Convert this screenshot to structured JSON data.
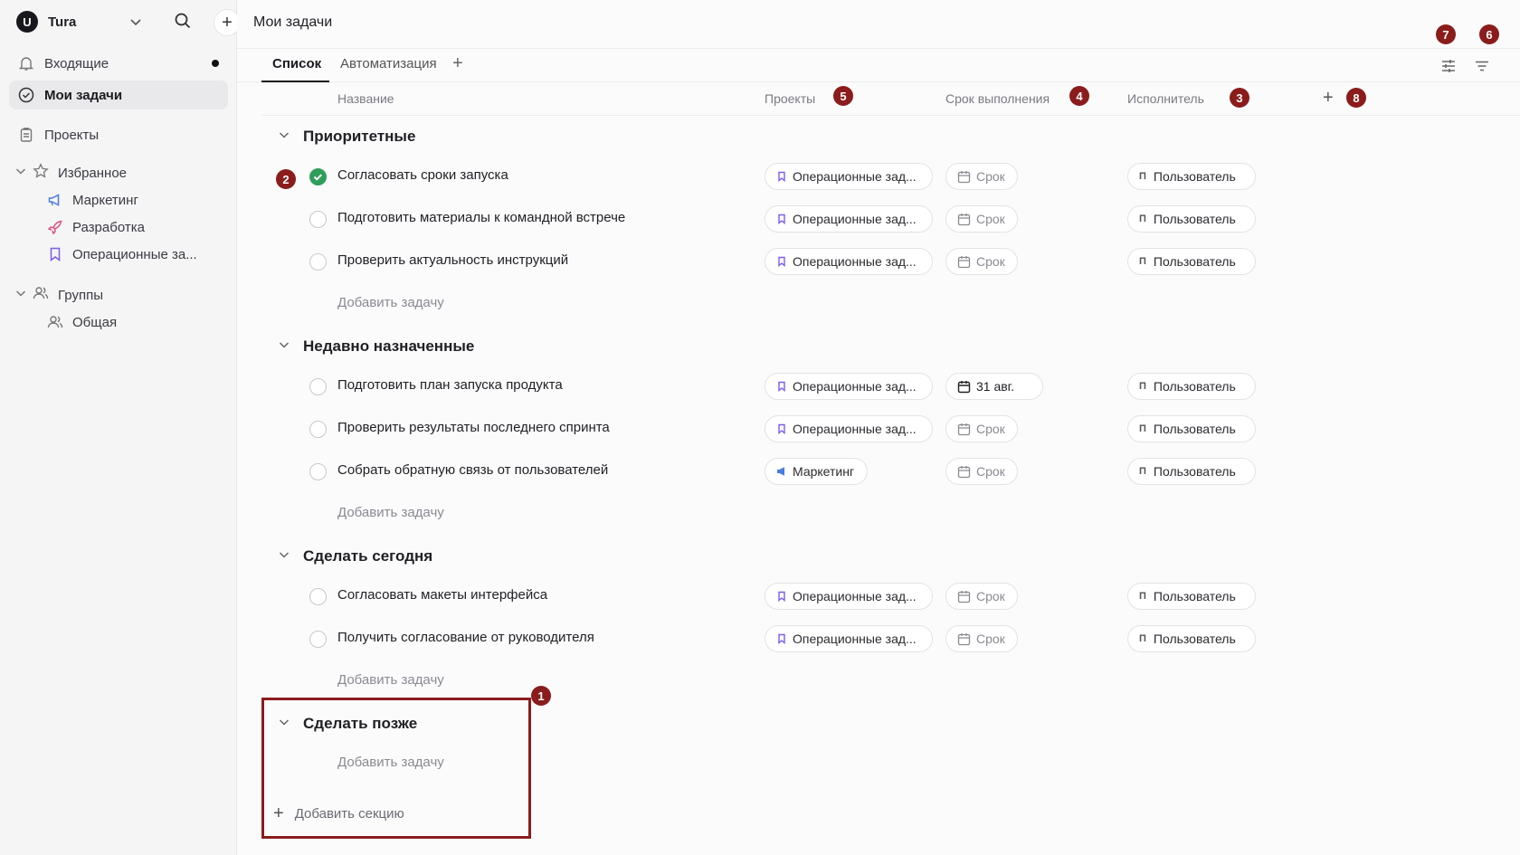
{
  "workspace": {
    "logo": "U",
    "name": "Tura"
  },
  "sidebar": {
    "inbox": "Входящие",
    "my_tasks": "Мои задачи",
    "projects": "Проекты",
    "favorites": {
      "label": "Избранное",
      "items": [
        "Маркетинг",
        "Разработка",
        "Операционные за..."
      ]
    },
    "groups": {
      "label": "Группы",
      "items": [
        "Общая"
      ]
    }
  },
  "header": {
    "title": "Мои задачи"
  },
  "tabs": {
    "list": "Список",
    "automation": "Автоматизация",
    "add": "+"
  },
  "columns": {
    "name": "Название",
    "projects": "Проекты",
    "due": "Срок выполнения",
    "assignee": "Исполнитель",
    "add": "+"
  },
  "sections": [
    {
      "title": "Приоритетные",
      "tasks": [
        {
          "title": "Согласовать сроки запуска",
          "done": true,
          "project": "Операционные зад...",
          "due": "Срок",
          "assignee": "Пользователь"
        },
        {
          "title": "Подготовить материалы к командной встрече",
          "done": false,
          "project": "Операционные зад...",
          "due": "Срок",
          "assignee": "Пользователь"
        },
        {
          "title": "Проверить актуальность инструкций",
          "done": false,
          "project": "Операционные зад...",
          "due": "Срок",
          "assignee": "Пользователь"
        }
      ],
      "add_task": "Добавить задачу"
    },
    {
      "title": "Недавно назначенные",
      "tasks": [
        {
          "title": "Подготовить план запуска продукта",
          "done": false,
          "project": "Операционные зад...",
          "due": "31 авг.",
          "assignee": "Пользователь"
        },
        {
          "title": "Проверить результаты последнего спринта",
          "done": false,
          "project": "Операционные зад...",
          "due": "Срок",
          "assignee": "Пользователь"
        },
        {
          "title": "Собрать обратную связь от пользователей",
          "done": false,
          "project": "Маркетинг",
          "due": "Срок",
          "assignee": "Пользователь"
        }
      ],
      "add_task": "Добавить задачу"
    },
    {
      "title": "Сделать сегодня",
      "tasks": [
        {
          "title": "Согласовать макеты интерфейса",
          "done": false,
          "project": "Операционные зад...",
          "due": "Срок",
          "assignee": "Пользователь"
        },
        {
          "title": "Получить согласование от руководителя",
          "done": false,
          "project": "Операционные зад...",
          "due": "Срок",
          "assignee": "Пользователь"
        }
      ],
      "add_task": "Добавить задачу"
    },
    {
      "title": "Сделать позже",
      "tasks": [],
      "add_task": "Добавить задачу"
    }
  ],
  "add_section": "Добавить секцию",
  "assignee_initial": "П",
  "markers": [
    "1",
    "2",
    "3",
    "4",
    "5",
    "6",
    "7",
    "8"
  ],
  "colors": {
    "accent_done": "#2f9e5a",
    "marker": "#8b1c1c",
    "marketing_icon": "#4a7be0",
    "dev_icon": "#e0507a",
    "ops_icon": "#7b5cf0"
  }
}
